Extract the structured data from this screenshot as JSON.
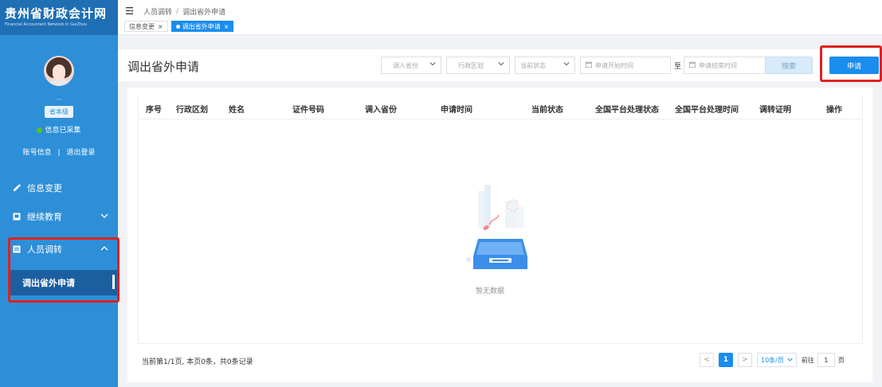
{
  "brand": {
    "title": "贵州省财政会计网",
    "subtitle": "Financial Accountant Network in GuiZhou"
  },
  "user": {
    "name": "—",
    "level": "省本级",
    "collect_status": "信息已采集",
    "account_info_link": "账号信息",
    "separator": "|",
    "logout_link": "退出登录"
  },
  "sidebar": {
    "items": [
      {
        "label": "信息变更",
        "icon": "edit-icon"
      },
      {
        "label": "继续教育",
        "icon": "education-icon",
        "expanded": false
      },
      {
        "label": "人员调转",
        "icon": "transfer-icon",
        "expanded": true
      }
    ],
    "sub_item": {
      "label": "调出省外申请"
    }
  },
  "breadcrumb": {
    "parent": "人员调转",
    "separator": "/",
    "current": "调出省外申请"
  },
  "tabs": [
    {
      "label": "信息变更",
      "close": "×",
      "active": false
    },
    {
      "label": "调出省外申请",
      "close": "×",
      "active": true
    }
  ],
  "toolbar": {
    "page_title": "调出省外申请",
    "province_placeholder": "调入省份",
    "district_placeholder": "行政区划",
    "status_placeholder": "当前状态",
    "start_date_placeholder": "申请开始时间",
    "to_label": "至",
    "end_date_placeholder": "申请结束时间",
    "search_label": "搜索",
    "apply_label": "申请"
  },
  "table": {
    "columns": [
      "序号",
      "行政区划",
      "姓名",
      "证件号码",
      "调入省份",
      "申请时间",
      "当前状态",
      "全国平台处理状态",
      "全国平台处理时间",
      "调转证明",
      "操作"
    ],
    "rows": [],
    "empty_text": "暂无数据"
  },
  "pagination": {
    "summary": "当前第1/1页, 本页0条，共0条记录",
    "prev": "<",
    "current_page": "1",
    "next": ">",
    "page_size": "10条/页",
    "goto_prefix": "前往",
    "goto_value": "1",
    "goto_suffix": "页"
  },
  "colors": {
    "sidebar_bg": "#2d8fd8",
    "brand_bg": "#1f6fb5",
    "active_sub_bg": "#1b5fa0",
    "primary": "#1a8dee",
    "highlight_box": "#e02020",
    "success_dot": "#52c41a"
  }
}
